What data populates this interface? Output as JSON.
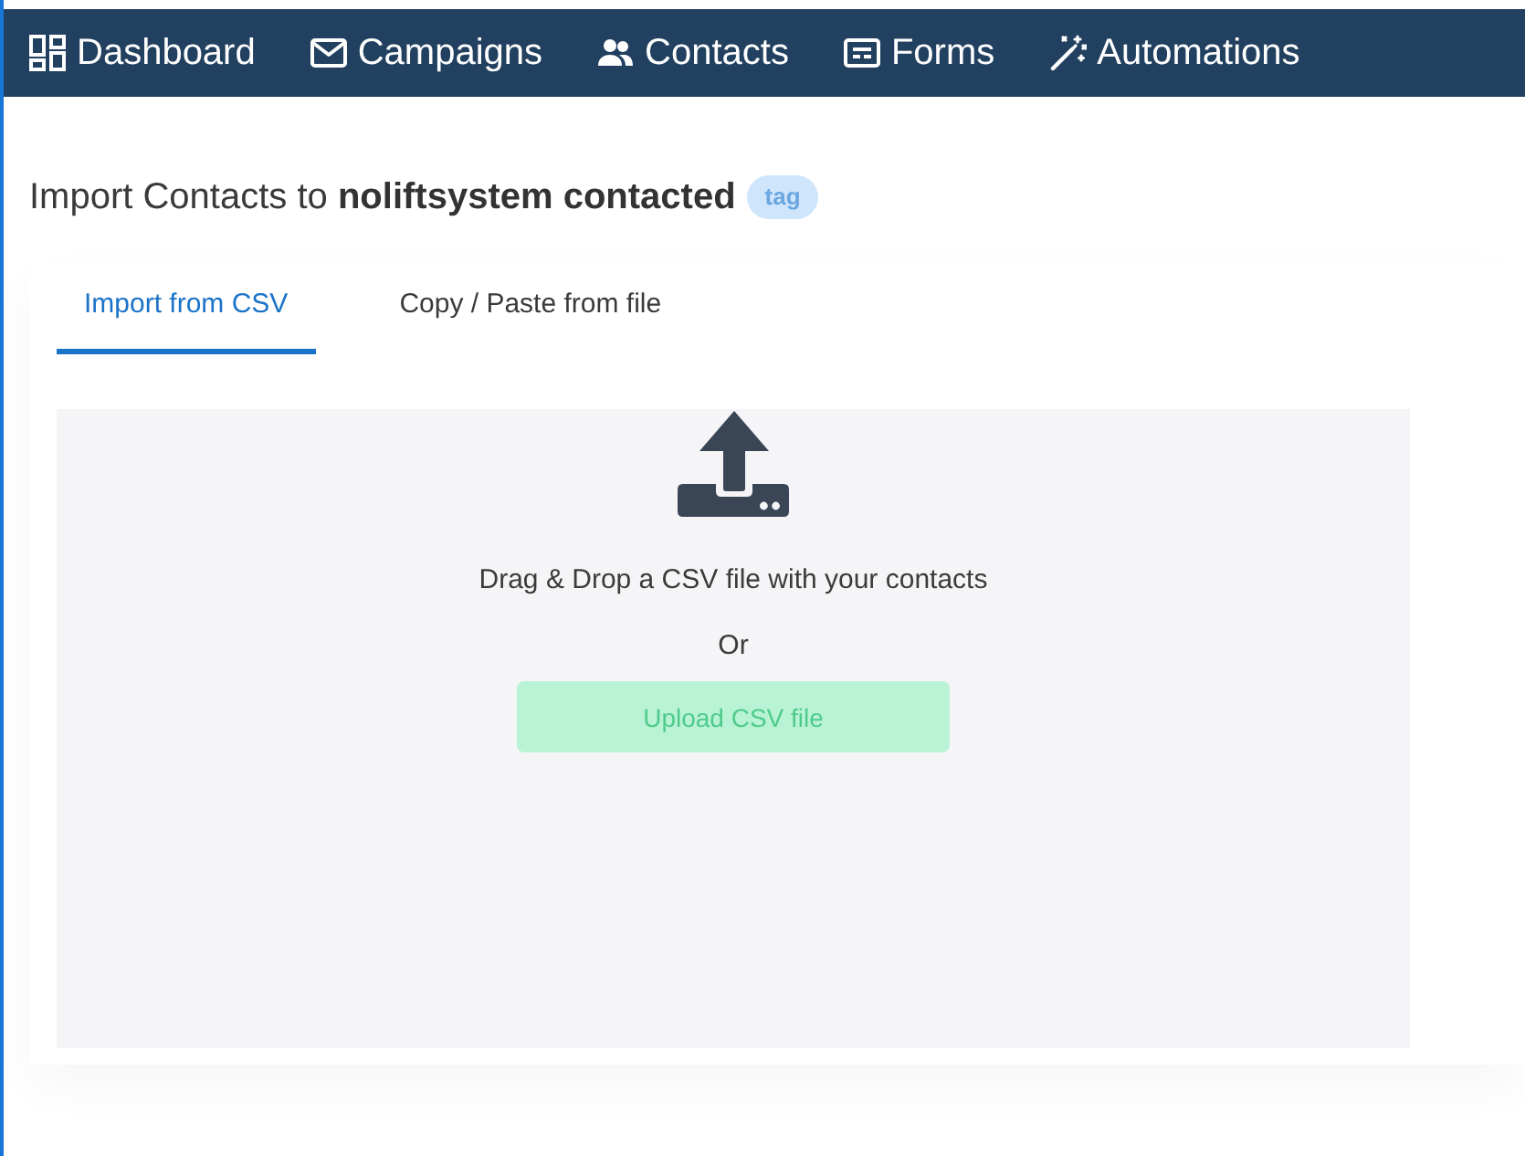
{
  "nav": [
    {
      "label": "Dashboard"
    },
    {
      "label": "Campaigns"
    },
    {
      "label": "Contacts"
    },
    {
      "label": "Forms"
    },
    {
      "label": "Automations"
    }
  ],
  "page": {
    "title": "Import Contacts to **noliftsystem contacted**",
    "tag": "tag"
  },
  "tabs": [
    {
      "label": "Import from CSV",
      "selected": true
    },
    {
      "label": "Copy / Paste from file",
      "selected": false
    }
  ],
  "dropzone": {
    "instruction": "Drag & Drop a CSV file with your contacts",
    "separator": "Or",
    "button": {
      "label": "Upload CSV file",
      "disabled": true
    }
  }
}
